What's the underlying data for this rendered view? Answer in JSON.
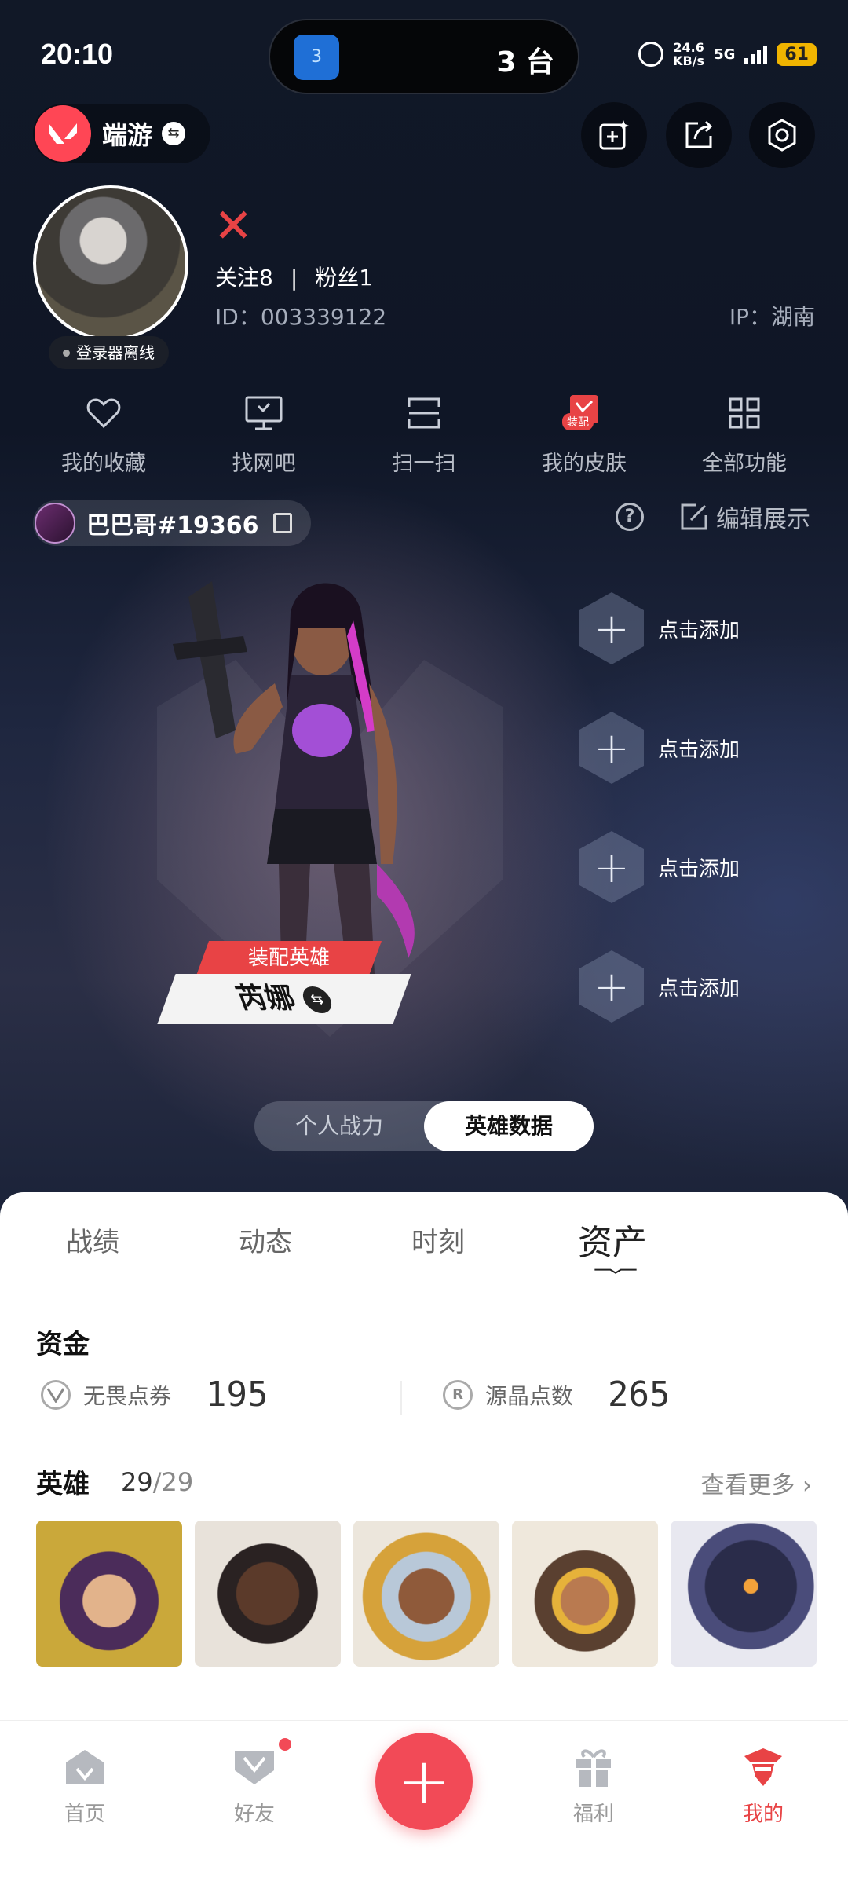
{
  "status": {
    "time": "20:10",
    "island_badge": "3",
    "island_text": "3 台",
    "net_speed_value": "24.6",
    "net_speed_unit": "KB/s",
    "network": "5G",
    "battery": "61"
  },
  "header": {
    "game_name": "端游"
  },
  "profile": {
    "status_text": "登录器离线",
    "follow_label": "关注",
    "follow_count": "8",
    "fans_label": "粉丝",
    "fans_count": "1",
    "separator": "|",
    "id_text": "ID：003339122",
    "ip_text": "IP：湖南"
  },
  "functions": [
    {
      "label": "我的收藏",
      "icon": "heart-icon"
    },
    {
      "label": "找网吧",
      "icon": "monitor-icon"
    },
    {
      "label": "扫一扫",
      "icon": "scan-icon"
    },
    {
      "label": "我的皮肤",
      "icon": "skin-icon",
      "badge": "装配"
    },
    {
      "label": "全部功能",
      "icon": "grid-icon"
    }
  ],
  "player": {
    "name": "巴巴哥#19366"
  },
  "showcase": {
    "edit_label": "编辑展示",
    "help_symbol": "?",
    "equip_tag": "装配英雄",
    "hero_name": "芮娜",
    "slots": [
      "点击添加",
      "点击添加",
      "点击添加",
      "点击添加"
    ]
  },
  "toggle": {
    "left": "个人战力",
    "right": "英雄数据",
    "active": "right"
  },
  "tabs": [
    "战绩",
    "动态",
    "时刻",
    "资产"
  ],
  "active_tab": "资产",
  "assets": {
    "section_title": "资金",
    "currencies": [
      {
        "label": "无畏点券",
        "value": "195",
        "icon": "valorant-points-icon"
      },
      {
        "label": "源晶点数",
        "value": "265",
        "icon": "radianite-icon",
        "symbol": "R"
      }
    ]
  },
  "heroes": {
    "title": "英雄",
    "owned": "29",
    "slash": "/",
    "total": "29",
    "more_label": "查看更多"
  },
  "nav": {
    "home": "首页",
    "friends": "好友",
    "welfare": "福利",
    "mine": "我的"
  },
  "colors": {
    "accent": "#e84345",
    "plus": "#f24a57",
    "panel": "#ffffff"
  }
}
